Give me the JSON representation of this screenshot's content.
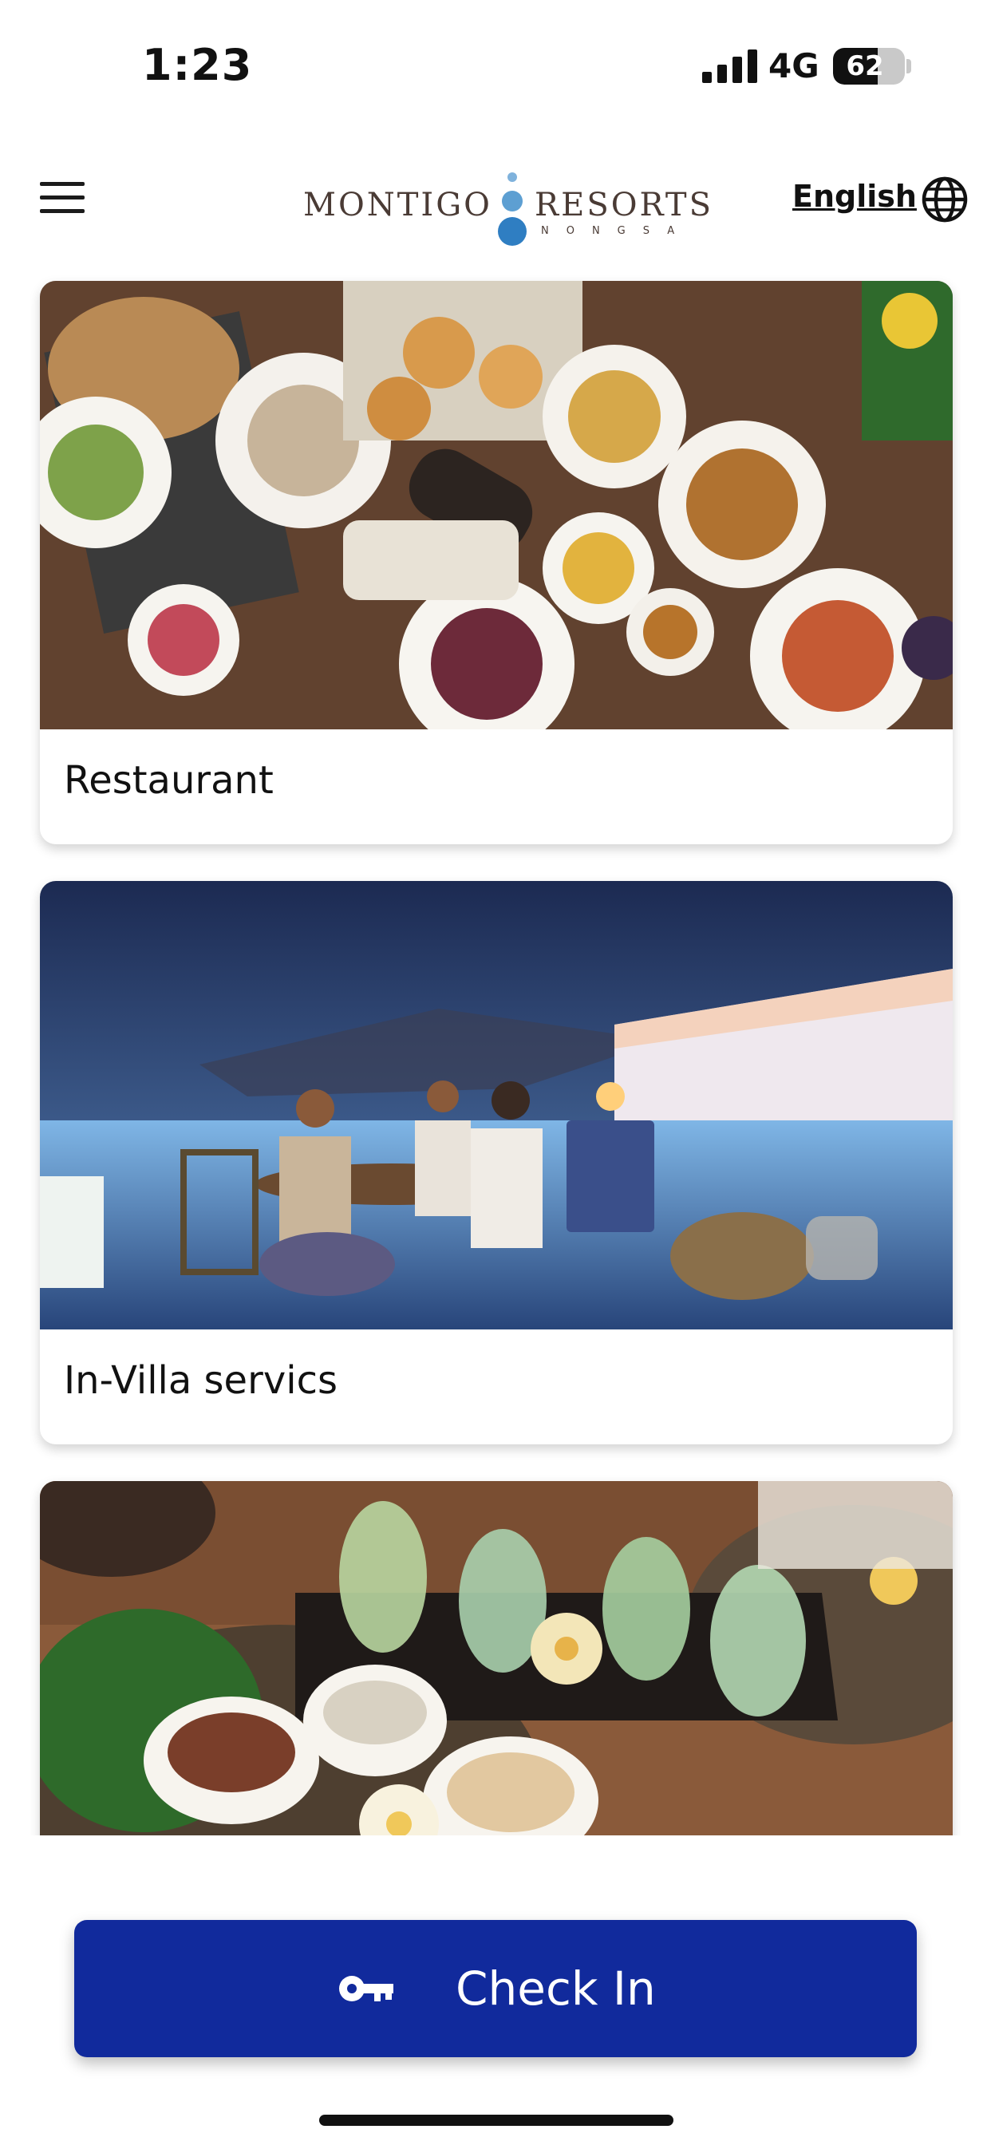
{
  "status_bar": {
    "time": "1:23",
    "network": "4G",
    "battery_level": "62",
    "battery_fraction": 0.62
  },
  "header": {
    "menu_icon": "hamburger-icon",
    "logo": {
      "left": "MONTIGO",
      "right": "RESORTS",
      "sub": "NONGSA"
    },
    "language_label": "English",
    "language_icon": "globe-icon"
  },
  "cards": [
    {
      "title": "Restaurant",
      "image": "food-spread-photo"
    },
    {
      "title": "In-Villa servics",
      "image": "villa-dinner-photo"
    },
    {
      "title": "",
      "image": "spa-oils-photo"
    }
  ],
  "checkin": {
    "label": "Check In",
    "icon": "key-icon",
    "color": "#112a9c"
  }
}
